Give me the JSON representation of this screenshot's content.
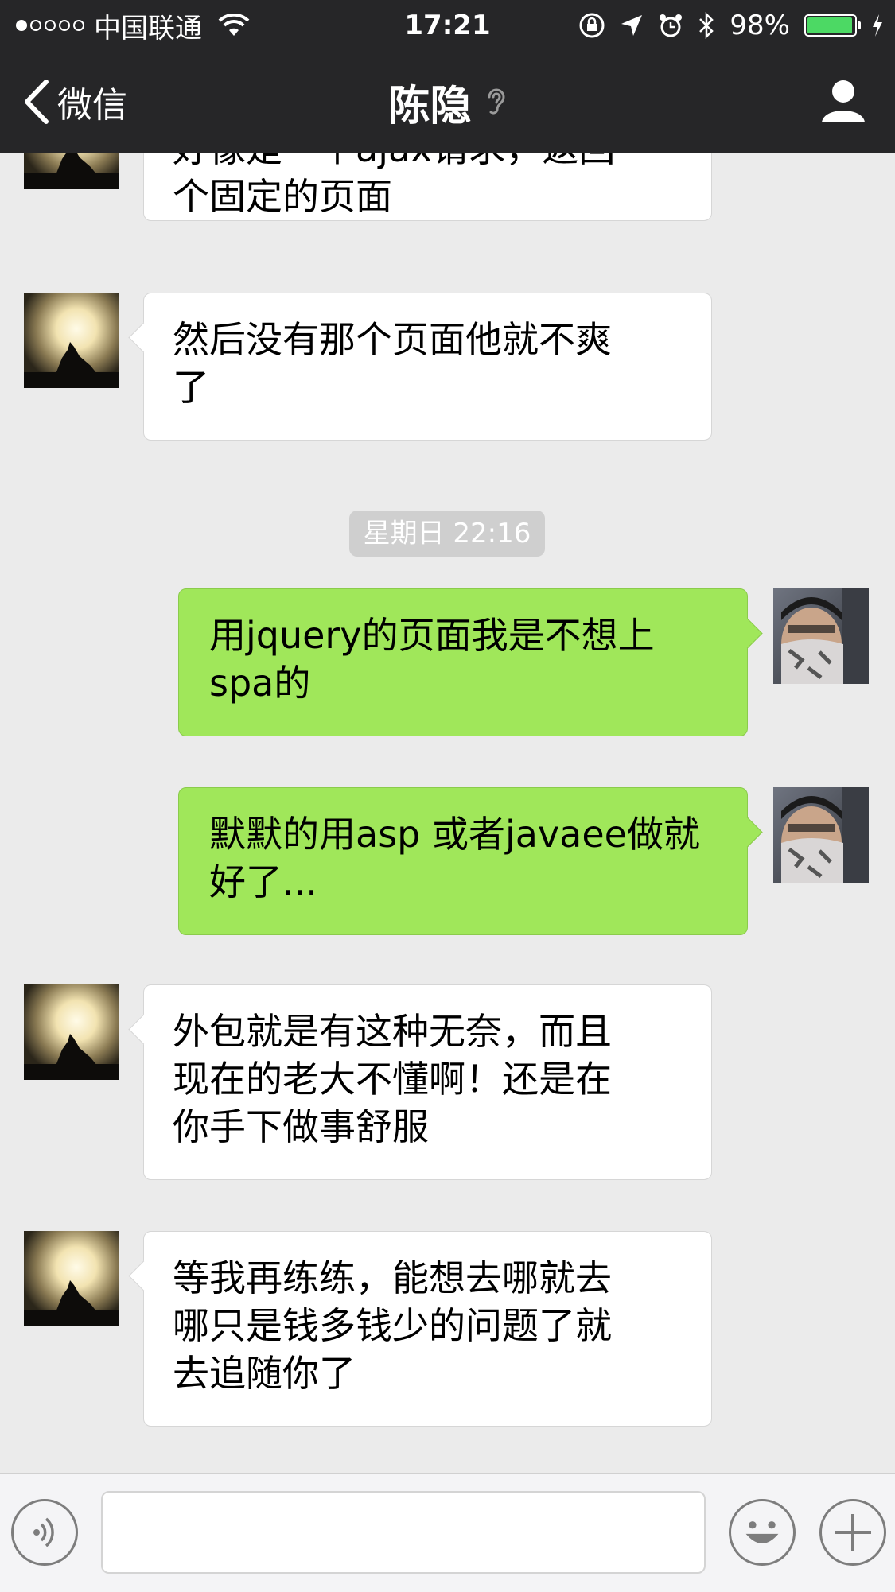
{
  "status_bar": {
    "carrier": "中国联通",
    "time": "17:21",
    "battery": "98%",
    "battery_level": 0.98,
    "signal_bars": 1
  },
  "nav": {
    "back_label": "微信",
    "title": "陈隐",
    "icons": [
      "chevron-left-icon",
      "ear-icon",
      "profile-icon"
    ]
  },
  "chat": {
    "messages": [
      {
        "side": "left",
        "text": "好像是一个ajax请求，返回\n个固定的页面"
      },
      {
        "side": "left",
        "text": "然后没有那个页面他就不爽\n了"
      },
      {
        "type": "timestamp",
        "text": "星期日 22:16"
      },
      {
        "side": "right",
        "text": "用jquery的页面我是不想上\nspa的"
      },
      {
        "side": "right",
        "text": "默默的用asp 或者javaee做就\n好了..."
      },
      {
        "side": "left",
        "text": "外包就是有这种无奈，而且\n现在的老大不懂啊！还是在\n你手下做事舒服"
      },
      {
        "side": "left",
        "text": "等我再练练，能想去哪就去\n哪只是钱多钱少的问题了就\n去追随你了"
      }
    ]
  },
  "input_bar": {
    "text_value": "",
    "icons": [
      "voice-icon",
      "emoji-icon",
      "plus-icon"
    ]
  },
  "colors": {
    "header_bg": "#262628",
    "chat_bg": "#ebebeb",
    "bubble_out": "#a0e75a",
    "bubble_in": "#ffffff",
    "battery_fill": "#4cd964"
  }
}
